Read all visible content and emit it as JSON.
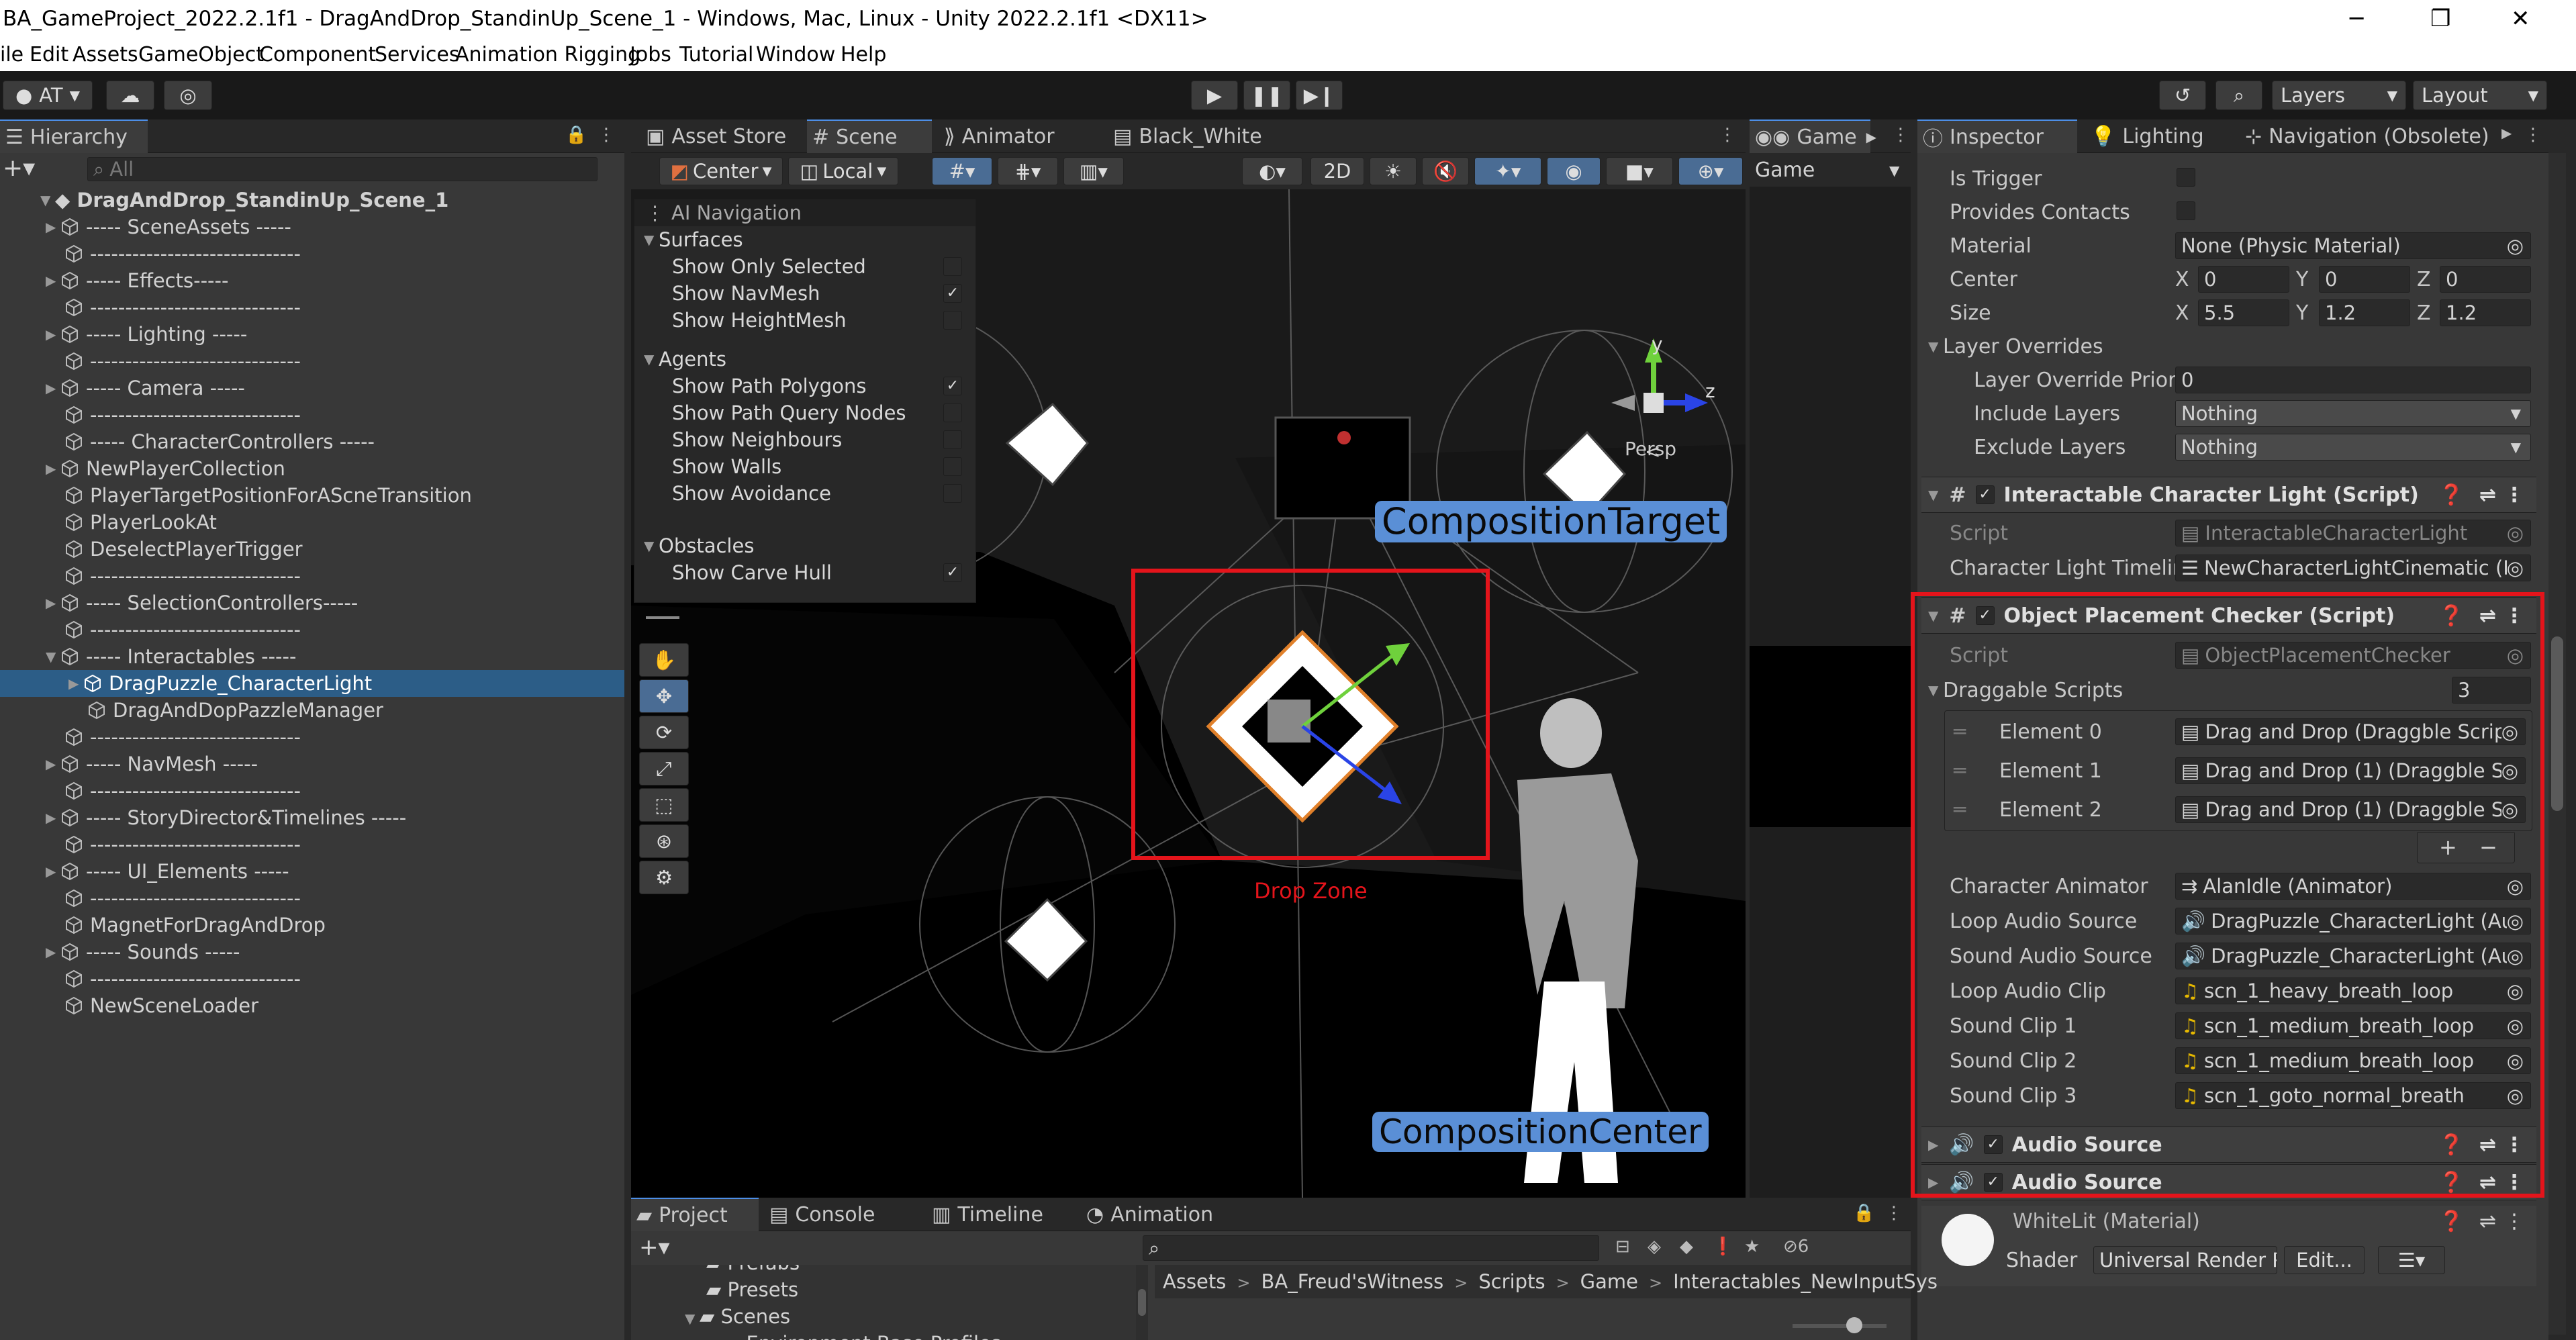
{
  "window": {
    "title": "BA_GameProject_2022.2.1f1 - DragAndDrop_StandinUp_Scene_1 - Windows, Mac, Linux - Unity 2022.2.1f1 <DX11>",
    "minimize": "─",
    "maximize": "❐",
    "close": "✕"
  },
  "menu": [
    "ile",
    "Edit",
    "Assets",
    "GameObject",
    "Component",
    "Services",
    "Animation Rigging",
    "Jobs",
    "Tutorial",
    "Window",
    "Help"
  ],
  "toolbar": {
    "account": "AT",
    "layers": "Layers",
    "layout": "Layout"
  },
  "hierarchy": {
    "tab": "Hierarchy",
    "search_placeholder": "All",
    "scene": "DragAndDrop_StandinUp_Scene_1",
    "items": [
      "----- SceneAssets -----",
      "------------------------------",
      "----- Effects-----",
      "------------------------------",
      "----- Lighting -----",
      "------------------------------",
      "----- Camera -----",
      "------------------------------",
      "----- CharacterControllers -----",
      "NewPlayerCollection",
      "PlayerTargetPositionForAScneTransition",
      "PlayerLookAt",
      "DeselectPlayerTrigger",
      "------------------------------",
      "----- SelectionControllers-----",
      "------------------------------",
      "----- Interactables -----",
      "DragPuzzle_CharacterLight",
      "DragAndDopPazzleManager",
      "------------------------------",
      "----- NavMesh -----",
      "------------------------------",
      "----- StoryDirector&Timelines -----",
      "------------------------------",
      "----- UI_Elements -----",
      "------------------------------",
      "MagnetForDragAndDrop",
      "----- Sounds -----",
      "------------------------------",
      "NewSceneLoader"
    ]
  },
  "scene_tabs": [
    "Asset Store",
    "Scene",
    "Animator",
    "Black_White"
  ],
  "scene_toolbar": {
    "pivot": "Center",
    "space": "Local",
    "mode2d": "2D"
  },
  "overlay": {
    "header": "AI Navigation",
    "surfaces": "Surfaces",
    "surface_items": [
      {
        "label": "Show Only Selected",
        "checked": false
      },
      {
        "label": "Show NavMesh",
        "checked": true
      },
      {
        "label": "Show HeightMesh",
        "checked": false
      }
    ],
    "agents": "Agents",
    "agent_items": [
      {
        "label": "Show Path Polygons",
        "checked": true
      },
      {
        "label": "Show Path Query Nodes",
        "checked": false
      },
      {
        "label": "Show Neighbours",
        "checked": false
      },
      {
        "label": "Show Walls",
        "checked": false
      },
      {
        "label": "Show Avoidance",
        "checked": false
      }
    ],
    "obstacles": "Obstacles",
    "obstacle_items": [
      {
        "label": "Show Carve Hull",
        "checked": true
      }
    ]
  },
  "scene_labels": {
    "composition_target": "CompositionTarget",
    "composition_center": "CompositionCenter",
    "drop_zone": "Drop Zone",
    "persp": "Persp",
    "axis_y": "y",
    "axis_z": "z"
  },
  "game_panel": {
    "tab": "Game",
    "dropdown": "Game"
  },
  "inspector": {
    "tabs": [
      "Inspector",
      "Lighting",
      "Navigation (Obsolete)"
    ],
    "collider": {
      "is_trigger": "Is Trigger",
      "provides_contacts": "Provides Contacts",
      "material_label": "Material",
      "material_value": "None (Physic Material)",
      "center_label": "Center",
      "center": [
        "0",
        "0",
        "0"
      ],
      "size_label": "Size",
      "size": [
        "5.5",
        "1.2",
        "1.2"
      ],
      "axes": [
        "X",
        "Y",
        "Z"
      ],
      "layer_overrides": "Layer Overrides",
      "layer_priority_label": "Layer Override Priori",
      "layer_priority_value": "0",
      "include_label": "Include Layers",
      "include_value": "Nothing",
      "exclude_label": "Exclude Layers",
      "exclude_value": "Nothing"
    },
    "light_script": {
      "title": "Interactable Character Light (Script)",
      "script_label": "Script",
      "script_value": "InteractableCharacterLight",
      "timeline_label": "Character Light Timelin",
      "timeline_value": "NewCharacterLightCinematic (F"
    },
    "checker": {
      "title": "Object Placement Checker (Script)",
      "script_label": "Script",
      "script_value": "ObjectPlacementChecker",
      "draggable_label": "Draggable Scripts",
      "draggable_count": "3",
      "elements": [
        {
          "label": "Element 0",
          "value": "Drag and Drop (Draggble Scrip"
        },
        {
          "label": "Element 1",
          "value": "Drag and Drop (1) (Draggble S"
        },
        {
          "label": "Element 2",
          "value": "Drag and Drop (1) (Draggble S"
        }
      ],
      "plus": "+",
      "minus": "−",
      "fields": [
        {
          "label": "Character Animator",
          "value": "AlanIdle (Animator)"
        },
        {
          "label": "Loop Audio Source",
          "value": "DragPuzzle_CharacterLight (Au"
        },
        {
          "label": "Sound Audio Source",
          "value": "DragPuzzle_CharacterLight (Au"
        },
        {
          "label": "Loop Audio Clip",
          "value": "scn_1_heavy_breath_loop"
        },
        {
          "label": "Sound Clip 1",
          "value": "scn_1_medium_breath_loop"
        },
        {
          "label": "Sound Clip 2",
          "value": "scn_1_medium_breath_loop"
        },
        {
          "label": "Sound Clip 3",
          "value": "scn_1_goto_normal_breath"
        }
      ]
    },
    "audio1": "Audio Source",
    "audio2": "Audio Source",
    "material": {
      "name": "WhiteLit (Material)",
      "shader_label": "Shader",
      "shader_value": "Universal Render Pipeline",
      "edit": "Edit..."
    }
  },
  "project": {
    "tabs": [
      "Project",
      "Console",
      "Timeline",
      "Animation"
    ],
    "folders": [
      "Prefabs",
      "Presets",
      "Scenes",
      "Environment Base Profiles"
    ],
    "breadcrumb": [
      "Assets",
      "BA_Freud'sWitness",
      "Scripts",
      "Game",
      "Interactables_NewInputSys"
    ],
    "hidden_count": "6"
  },
  "colors": {
    "highlight": "#e4141b",
    "selection": "#2c5d87",
    "accent": "#4d8ee6",
    "label_blue": "#5a8fd6"
  }
}
